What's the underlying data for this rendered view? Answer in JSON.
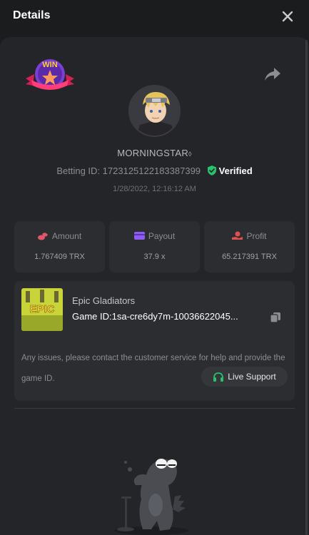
{
  "header": {
    "title": "Details"
  },
  "profile": {
    "username": "MORNINGSTAR",
    "betting_id_label": "Betting ID:",
    "betting_id": "1723125122183387399",
    "verified": "Verified",
    "timestamp": "1/28/2022, 12:16:12 AM",
    "badge_text": "WIN"
  },
  "stats": [
    {
      "label": "Amount",
      "value": "1.767409 TRX",
      "icon": "coins-icon",
      "color": "#e0566b"
    },
    {
      "label": "Payout",
      "value": "37.9 x",
      "icon": "wallet-icon",
      "color": "#8f5cf2"
    },
    {
      "label": "Profit",
      "value": "65.217391 TRX",
      "icon": "hand-coin-icon",
      "color": "#e05050"
    }
  ],
  "game": {
    "name": "Epic Gladiators",
    "game_id": "Game ID:1sa-cre6dy7m-10036622045...",
    "thumb_text": "EPIC",
    "help_text": "Any issues, please contact the customer service for help and provide the game ID.",
    "support_label": "Live Support"
  },
  "colors": {
    "accent_green": "#27c26b",
    "panel": "#242528",
    "card": "#2c2d31"
  }
}
